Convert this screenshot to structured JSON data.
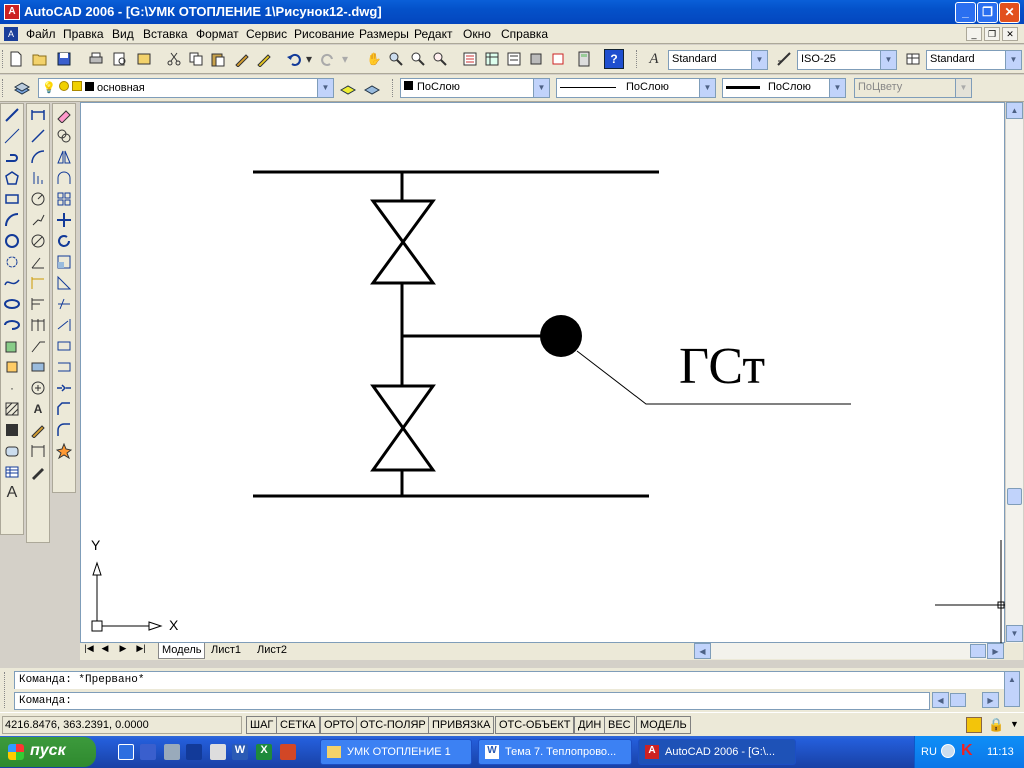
{
  "app": {
    "title": "AutoCAD 2006 - [G:\\УМК ОТОПЛЕНИЕ 1\\Рисунок12-.dwg]",
    "min_label": "_",
    "restore_label": "❐",
    "close_label": "✕"
  },
  "menu": [
    "Файл",
    "Правка",
    "Вид",
    "Вставка",
    "Формат",
    "Сервис",
    "Рисование",
    "Размеры",
    "Редакт",
    "Окно",
    "Справка"
  ],
  "toolbar": {
    "text_style": "Standard",
    "dim_style": "ISO-25",
    "table_style": "Standard",
    "layer": "основная",
    "color": "ПоСлою",
    "linetype": "ПоСлою",
    "lineweight": "ПоСлою",
    "plotstyle": "ПоЦвету"
  },
  "drawing": {
    "label": "ГСт",
    "ucs_x": "X",
    "ucs_y": "Y"
  },
  "tabs": [
    "Модель",
    "Лист1",
    "Лист2"
  ],
  "command": {
    "line1": "Команда: *Прервано*",
    "line2": "Команда:"
  },
  "status": {
    "coords": "4216.8476, 363.2391, 0.0000",
    "buttons": [
      "ШАГ",
      "СЕТКА",
      "ОРТО",
      "ОТС-ПОЛЯР",
      "ПРИВЯЗКА",
      "ОТС-ОБЪЕКТ",
      "ДИН",
      "ВЕС",
      "МОДЕЛЬ"
    ]
  },
  "taskbar": {
    "start": "пуск",
    "tasks": [
      "УМК ОТОПЛЕНИЕ 1",
      "Тема 7. Теплопрово...",
      "AutoCAD 2006 - [G:\\..."
    ],
    "lang": "RU",
    "clock": "11:13"
  }
}
